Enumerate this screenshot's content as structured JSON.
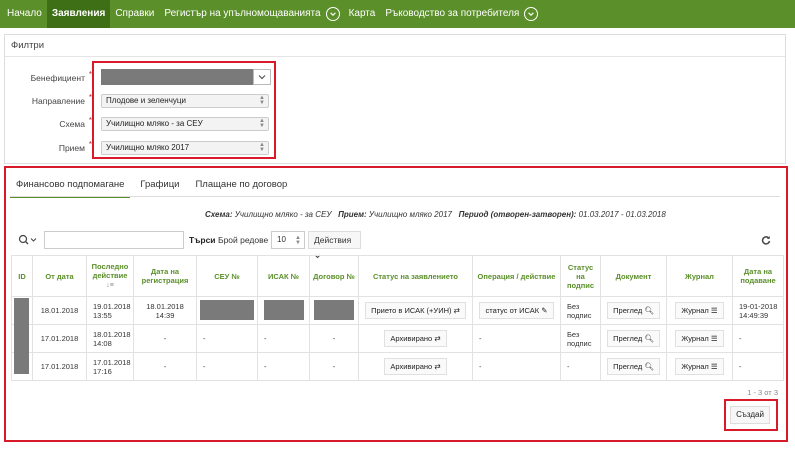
{
  "nav": {
    "items": [
      {
        "label": "Начало",
        "active": false
      },
      {
        "label": "Заявления",
        "active": true
      },
      {
        "label": "Справки",
        "active": false
      },
      {
        "label": "Регистър на упълномощаванията",
        "active": false
      },
      {
        "label": "Карта",
        "active": false
      },
      {
        "label": "Ръководство за потребителя",
        "active": false
      }
    ],
    "color": "#5b8f2a",
    "active_color": "#3e6f16"
  },
  "filters": {
    "title": "Филтри",
    "beneficiary_label": "Бенефициент",
    "direction_label": "Направление",
    "direction_value": "Плодове и зеленчуци",
    "scheme_label": "Схема",
    "scheme_value": "Училищно мляко - за СЕУ",
    "intake_label": "Прием",
    "intake_value": "Училищно мляко 2017",
    "required_mark": "*"
  },
  "tabs": [
    {
      "label": "Финансово подпомагане",
      "active": true
    },
    {
      "label": "Графици",
      "active": false
    },
    {
      "label": "Плащане по договор",
      "active": false
    }
  ],
  "info": {
    "scheme_label": "Схема:",
    "scheme_value": "Училищно мляко - за СЕУ",
    "intake_label": "Прием:",
    "intake_value": "Училищно мляко 2017",
    "period_label": "Период (отворен-затворен):",
    "period_value": "01.03.2017 - 01.03.2018"
  },
  "toolbar": {
    "search_label": "Търси",
    "rows_label": "Брой редове",
    "rows_value": "10",
    "actions_label": "Действия"
  },
  "table": {
    "headers": [
      "ID",
      "От дата",
      "Последно действие",
      "Дата на регистрация",
      "СЕУ №",
      "ИСАК №",
      "Договор №",
      "Статус на заявлението",
      "Операция / действие",
      "Статус на подпис",
      "Документ",
      "Журнал",
      "Дата на подаване"
    ],
    "rows": [
      {
        "from": "18.01.2018",
        "last": "19.01.2018 13:55",
        "reg": "18.01.2018 14:39",
        "status": "Прието в ИСАК (+УИН)",
        "op": "статус от ИСАК",
        "sign": "Без подпис",
        "doc": "Преглед",
        "journal": "Журнал",
        "submit": "19-01-2018 14:49:39"
      },
      {
        "from": "17.01.2018",
        "last": "18.01.2018 14:08",
        "reg": "-",
        "seu": "-",
        "isak": "-",
        "contract": "-",
        "status": "Архивирано",
        "op": "-",
        "sign": "Без подпис",
        "doc": "Преглед",
        "journal": "Журнал",
        "submit": "-"
      },
      {
        "from": "17.01.2018",
        "last": "17.01.2018 17:16",
        "reg": "-",
        "seu": "-",
        "isak": "-",
        "contract": "-",
        "status": "Архивирано",
        "op": "-",
        "sign": "-",
        "doc": "Преглед",
        "journal": "Журнал",
        "submit": "-"
      }
    ]
  },
  "pagination": "1 - 3 от 3",
  "create_label": "Създай",
  "highlight_color": "#d91a2a"
}
